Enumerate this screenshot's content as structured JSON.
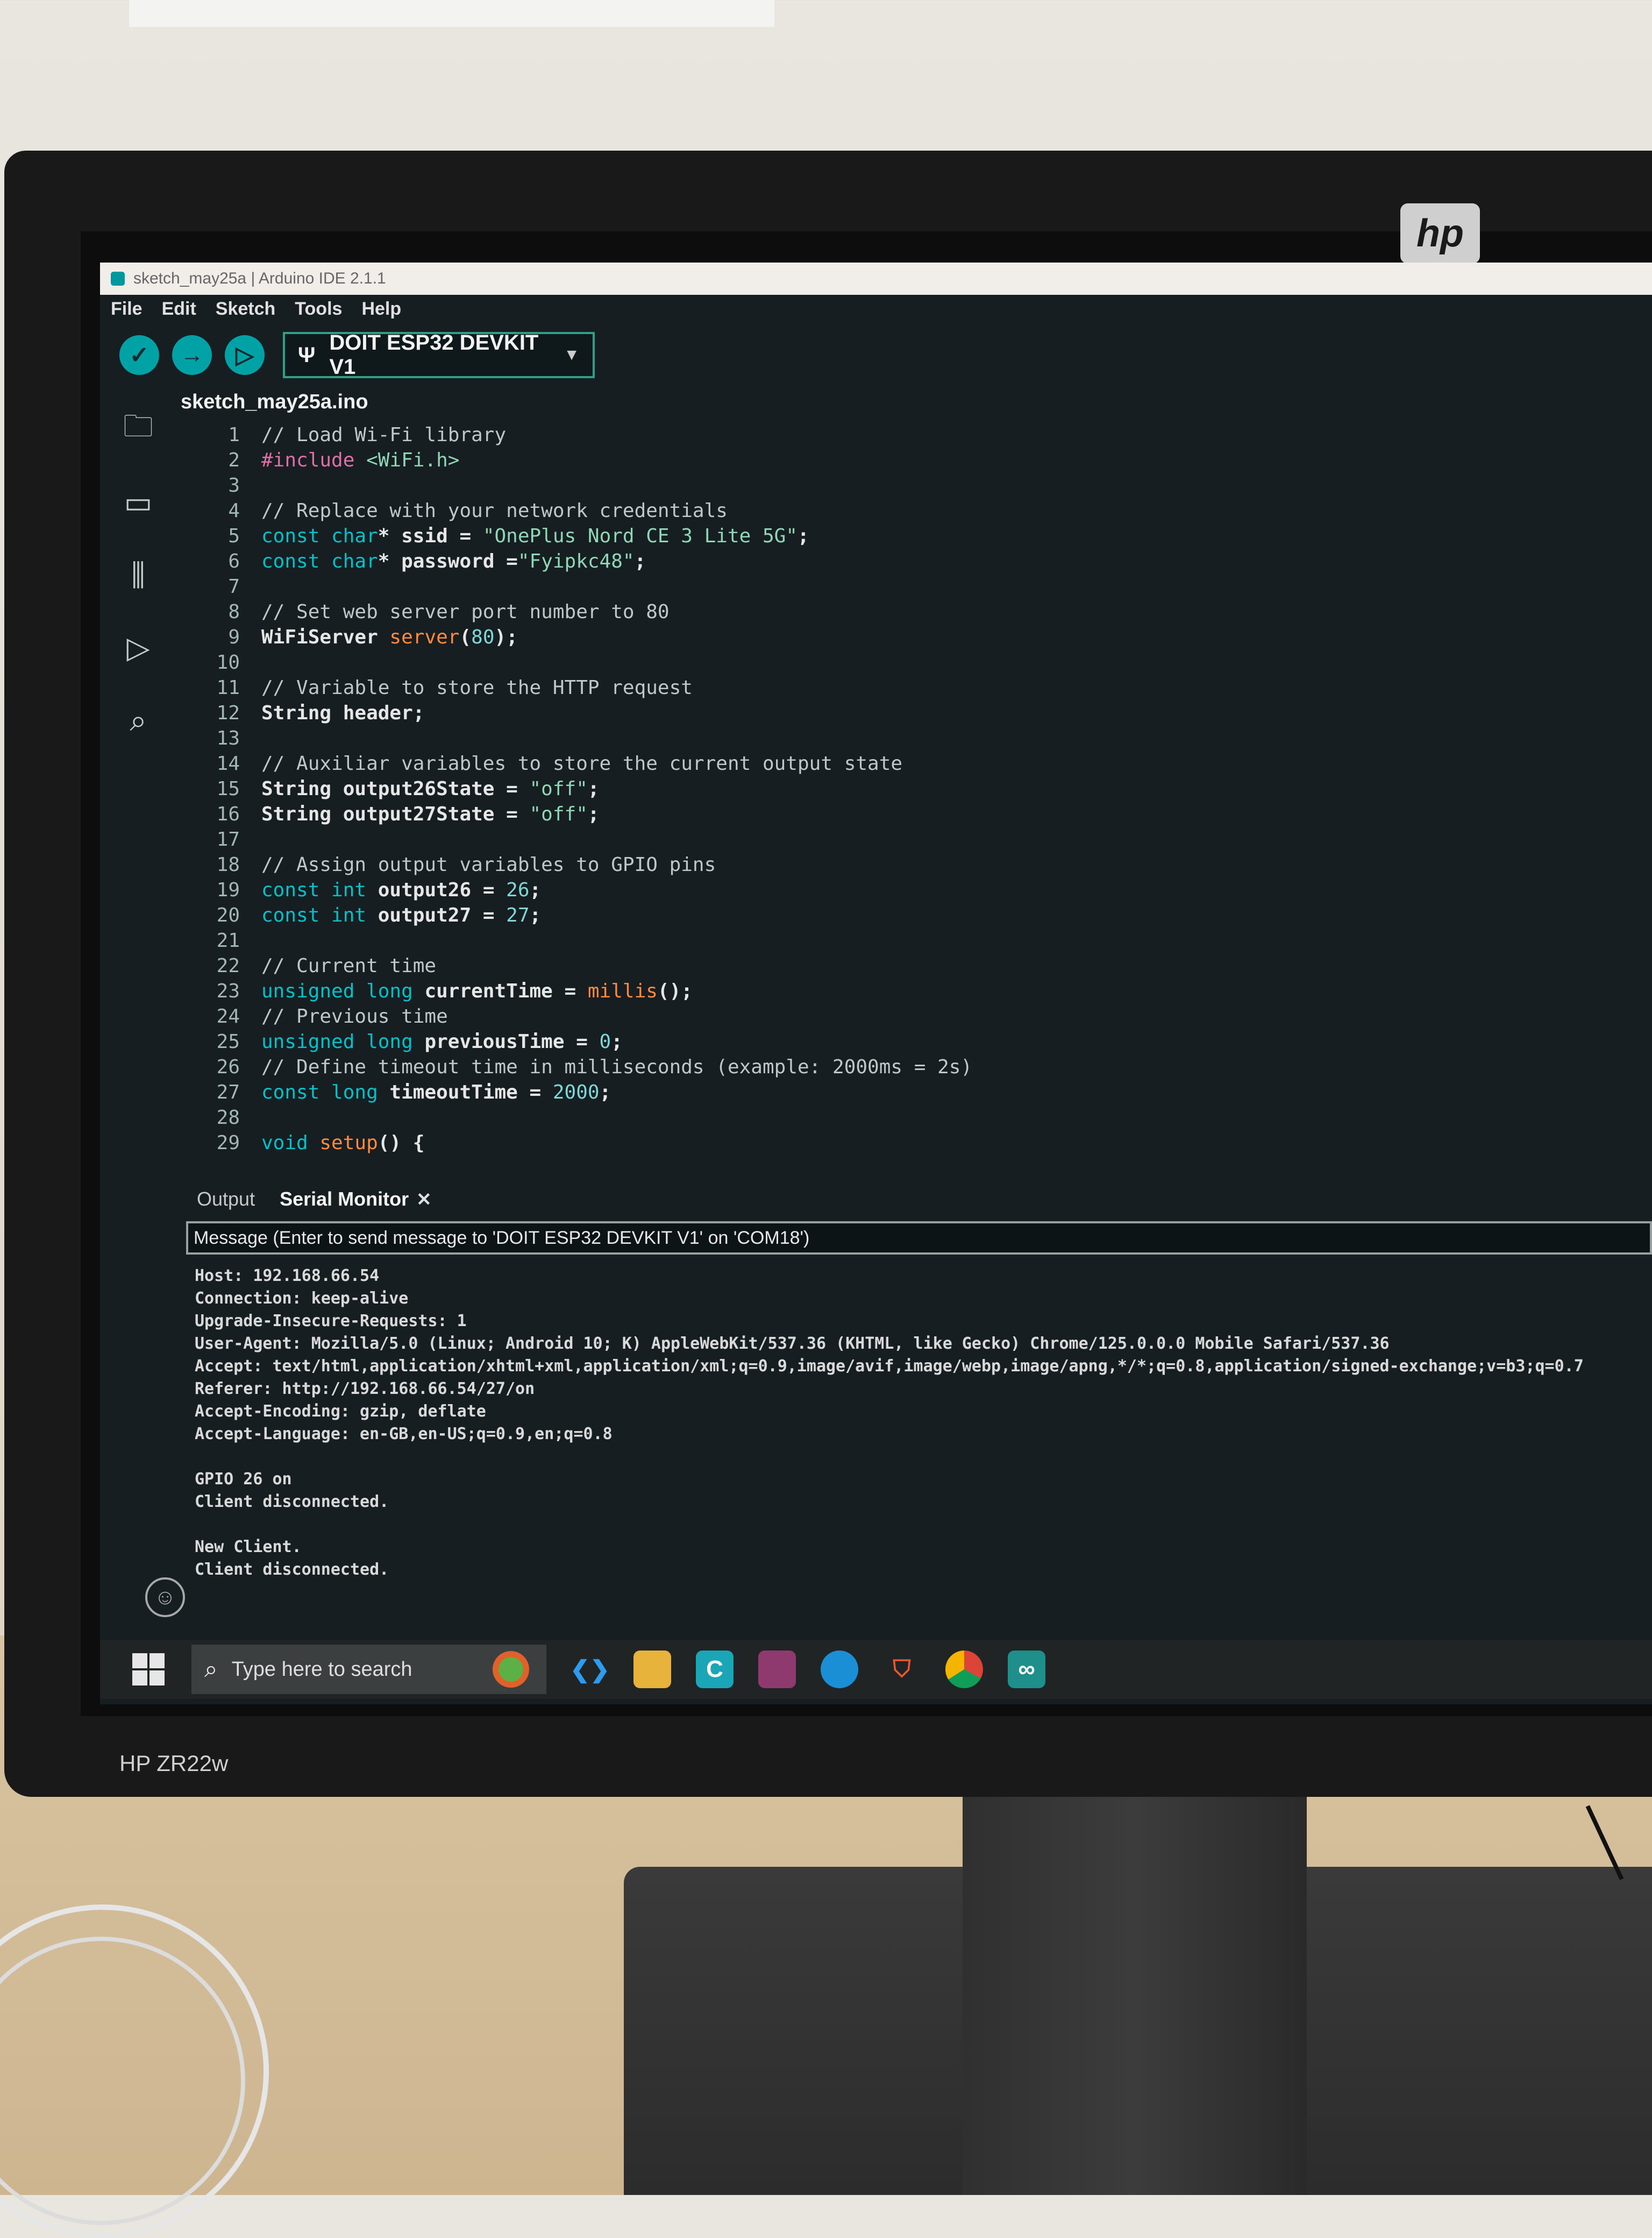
{
  "window": {
    "title": "sketch_may25a | Arduino IDE 2.1.1"
  },
  "menu": [
    "File",
    "Edit",
    "Sketch",
    "Tools",
    "Help"
  ],
  "toolbar": {
    "verify_icon": "check-icon",
    "upload_icon": "arrow-right-icon",
    "debug_icon": "debug-icon",
    "board_label": "DOIT ESP32 DEVKIT V1"
  },
  "editor": {
    "file_tab": "sketch_may25a.ino",
    "lines": [
      {
        "n": "1",
        "segs": [
          {
            "t": "// Load Wi-Fi library",
            "c": "comment"
          }
        ]
      },
      {
        "n": "2",
        "segs": [
          {
            "t": "#include ",
            "c": "pre"
          },
          {
            "t": "<WiFi.h>",
            "c": "str"
          }
        ]
      },
      {
        "n": "3",
        "segs": []
      },
      {
        "n": "4",
        "segs": [
          {
            "t": "// Replace with your network credentials",
            "c": "comment"
          }
        ]
      },
      {
        "n": "5",
        "segs": [
          {
            "t": "const char",
            "c": "kw"
          },
          {
            "t": "* ssid = ",
            "c": "plain"
          },
          {
            "t": "\"OnePlus Nord CE 3 Lite 5G\"",
            "c": "str"
          },
          {
            "t": ";",
            "c": "plain"
          }
        ]
      },
      {
        "n": "6",
        "segs": [
          {
            "t": "const char",
            "c": "kw"
          },
          {
            "t": "* password =",
            "c": "plain"
          },
          {
            "t": "\"Fyipkc48\"",
            "c": "str"
          },
          {
            "t": ";",
            "c": "plain"
          }
        ]
      },
      {
        "n": "7",
        "segs": []
      },
      {
        "n": "8",
        "segs": [
          {
            "t": "// Set web server port number to 80",
            "c": "comment"
          }
        ]
      },
      {
        "n": "9",
        "segs": [
          {
            "t": "WiFiServer ",
            "c": "plain"
          },
          {
            "t": "server",
            "c": "fn"
          },
          {
            "t": "(",
            "c": "plain"
          },
          {
            "t": "80",
            "c": "num"
          },
          {
            "t": ");",
            "c": "plain"
          }
        ]
      },
      {
        "n": "10",
        "segs": []
      },
      {
        "n": "11",
        "segs": [
          {
            "t": "// Variable to store the HTTP request",
            "c": "comment"
          }
        ]
      },
      {
        "n": "12",
        "segs": [
          {
            "t": "String header;",
            "c": "plain"
          }
        ]
      },
      {
        "n": "13",
        "segs": []
      },
      {
        "n": "14",
        "segs": [
          {
            "t": "// Auxiliar variables to store the current output state",
            "c": "comment"
          }
        ]
      },
      {
        "n": "15",
        "segs": [
          {
            "t": "String output26State = ",
            "c": "plain"
          },
          {
            "t": "\"off\"",
            "c": "str"
          },
          {
            "t": ";",
            "c": "plain"
          }
        ]
      },
      {
        "n": "16",
        "segs": [
          {
            "t": "String output27State = ",
            "c": "plain"
          },
          {
            "t": "\"off\"",
            "c": "str"
          },
          {
            "t": ";",
            "c": "plain"
          }
        ]
      },
      {
        "n": "17",
        "segs": []
      },
      {
        "n": "18",
        "segs": [
          {
            "t": "// Assign output variables to GPIO pins",
            "c": "comment"
          }
        ]
      },
      {
        "n": "19",
        "segs": [
          {
            "t": "const int ",
            "c": "kw"
          },
          {
            "t": "output26 = ",
            "c": "plain"
          },
          {
            "t": "26",
            "c": "num"
          },
          {
            "t": ";",
            "c": "plain"
          }
        ]
      },
      {
        "n": "20",
        "segs": [
          {
            "t": "const int ",
            "c": "kw"
          },
          {
            "t": "output27 = ",
            "c": "plain"
          },
          {
            "t": "27",
            "c": "num"
          },
          {
            "t": ";",
            "c": "plain"
          }
        ]
      },
      {
        "n": "21",
        "segs": []
      },
      {
        "n": "22",
        "segs": [
          {
            "t": "// Current time",
            "c": "comment"
          }
        ]
      },
      {
        "n": "23",
        "segs": [
          {
            "t": "unsigned long ",
            "c": "kw"
          },
          {
            "t": "currentTime = ",
            "c": "plain"
          },
          {
            "t": "millis",
            "c": "fn"
          },
          {
            "t": "();",
            "c": "plain"
          }
        ]
      },
      {
        "n": "24",
        "segs": [
          {
            "t": "// Previous time",
            "c": "comment"
          }
        ]
      },
      {
        "n": "25",
        "segs": [
          {
            "t": "unsigned long ",
            "c": "kw"
          },
          {
            "t": "previousTime = ",
            "c": "plain"
          },
          {
            "t": "0",
            "c": "num"
          },
          {
            "t": ";",
            "c": "plain"
          }
        ]
      },
      {
        "n": "26",
        "segs": [
          {
            "t": "// Define timeout time in milliseconds (example: 2000ms = 2s)",
            "c": "comment"
          }
        ]
      },
      {
        "n": "27",
        "segs": [
          {
            "t": "const long ",
            "c": "kw"
          },
          {
            "t": "timeoutTime = ",
            "c": "plain"
          },
          {
            "t": "2000",
            "c": "num"
          },
          {
            "t": ";",
            "c": "plain"
          }
        ]
      },
      {
        "n": "28",
        "segs": []
      },
      {
        "n": "29",
        "segs": [
          {
            "t": "void ",
            "c": "kw"
          },
          {
            "t": "setup",
            "c": "fn"
          },
          {
            "t": "() {",
            "c": "plain"
          }
        ]
      }
    ]
  },
  "panel": {
    "tabs": [
      "Output",
      "Serial Monitor"
    ],
    "message_placeholder": "Message (Enter to send message to 'DOIT ESP32 DEVKIT V1' on 'COM18')",
    "serial_lines": [
      "Host: 192.168.66.54",
      "Connection: keep-alive",
      "Upgrade-Insecure-Requests: 1",
      "User-Agent: Mozilla/5.0 (Linux; Android 10; K) AppleWebKit/537.36 (KHTML, like Gecko) Chrome/125.0.0.0 Mobile Safari/537.36",
      "Accept: text/html,application/xhtml+xml,application/xml;q=0.9,image/avif,image/webp,image/apng,*/*;q=0.8,application/signed-exchange;v=b3;q=0.7",
      "Referer: http://192.168.66.54/27/on",
      "Accept-Encoding: gzip, deflate",
      "Accept-Language: en-GB,en-US;q=0.9,en;q=0.8",
      "",
      "GPIO 26 on",
      "Client disconnected.",
      "",
      "New Client.",
      "Client disconnected."
    ]
  },
  "taskbar": {
    "search_placeholder": "Type here to search",
    "apps": [
      "vscode-icon",
      "file-explorer-icon",
      "app-c-icon",
      "winrar-icon",
      "edge-icon",
      "brave-icon",
      "chrome-icon",
      "arduino-icon"
    ]
  },
  "monitor": {
    "brand": "hp",
    "model": "HP ZR22w"
  },
  "colors": {
    "editor_bg": "#171e21",
    "accent": "#00a2a6",
    "keyword": "#00c3c9",
    "string": "#8fd8b5",
    "function": "#ff8a3c",
    "preprocessor": "#e06fa8"
  }
}
